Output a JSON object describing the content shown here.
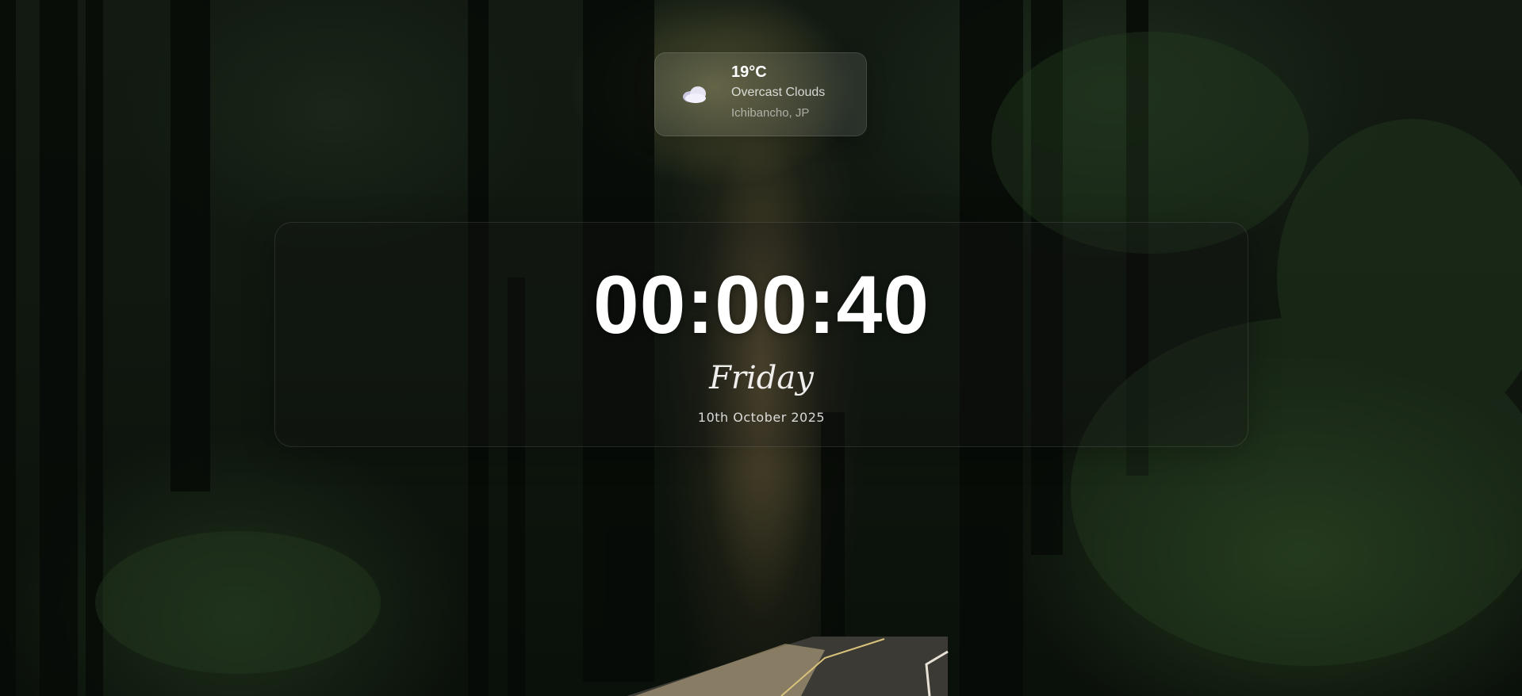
{
  "weather": {
    "temperature": "19°C",
    "condition": "Overcast Clouds",
    "location": "Ichibancho, JP",
    "icon": "cloud-icon"
  },
  "clock": {
    "time": "00:00:40",
    "day": "Friday",
    "date": "10th October 2025"
  },
  "background": {
    "scene": "forest-road-image"
  },
  "colors": {
    "text": "#ffffff",
    "card_glass": "#ffffff1a"
  }
}
